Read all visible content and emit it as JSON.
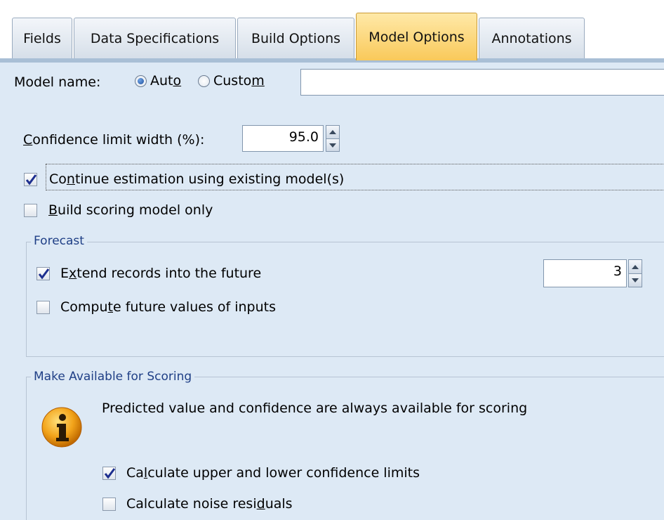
{
  "tabs": [
    {
      "label": "Fields"
    },
    {
      "label": "Data Specifications"
    },
    {
      "label": "Build Options"
    },
    {
      "label": "Model Options",
      "active": true
    },
    {
      "label": "Annotations"
    }
  ],
  "model_name": {
    "label": "Model name:",
    "options": [
      {
        "pre": "Aut",
        "mn": "o",
        "post": "",
        "selected": true
      },
      {
        "pre": "Custo",
        "mn": "m",
        "post": "",
        "selected": false
      }
    ],
    "value": ""
  },
  "confidence": {
    "pre": "",
    "mn": "C",
    "post": "onfidence limit width (%):",
    "value": "95.0"
  },
  "continue_estimation": {
    "pre": "Co",
    "mn": "n",
    "post": "tinue estimation using existing model(s)",
    "checked": true
  },
  "build_scoring": {
    "pre": "",
    "mn": "B",
    "post": "uild scoring model only",
    "checked": false
  },
  "forecast": {
    "title": "Forecast",
    "extend": {
      "pre": "E",
      "mn": "x",
      "post": "tend records into the future",
      "checked": true,
      "value": "3"
    },
    "compute": {
      "pre": "Compu",
      "mn": "t",
      "post": "e future values of inputs",
      "checked": false
    }
  },
  "scoring": {
    "title": "Make Available for Scoring",
    "info_text": "Predicted value and confidence are always available for scoring",
    "calc_limits": {
      "pre": "Ca",
      "mn": "l",
      "post": "culate upper and lower confidence limits",
      "checked": true
    },
    "calc_noise": {
      "pre": "Calculate noise resi",
      "mn": "d",
      "post": "uals",
      "checked": false
    }
  },
  "colors": {
    "panel": "#dde9f5",
    "active_tab": "#f9c95a",
    "group_title": "#1f3f86"
  }
}
